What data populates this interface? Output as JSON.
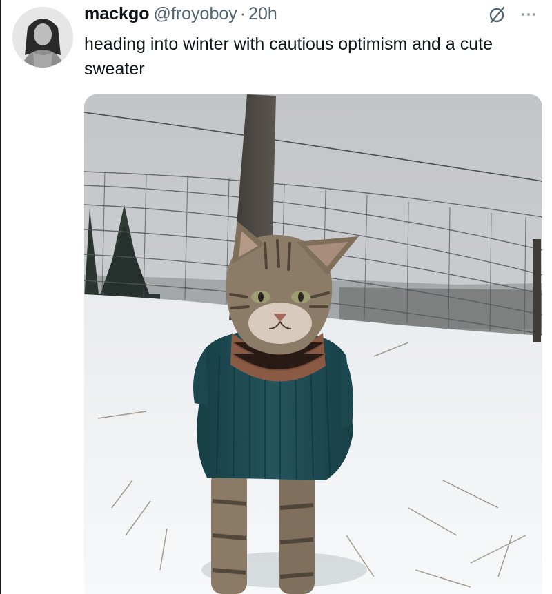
{
  "tweet": {
    "author_name": "mackgo",
    "author_handle": "@froyoboy",
    "separator": "·",
    "timestamp": "20h",
    "text": "heading into winter with cautious optimism and a cute sweater"
  },
  "icons": {
    "grok": "grok-icon",
    "more": "more-icon",
    "avatar": "avatar"
  },
  "media": {
    "subject": "photo"
  },
  "colors": {
    "text_primary": "#0f1419",
    "text_secondary": "#536471",
    "sweater": "#1f4f57",
    "snow": "#f4f6f8",
    "sky": "#c7cacd"
  }
}
